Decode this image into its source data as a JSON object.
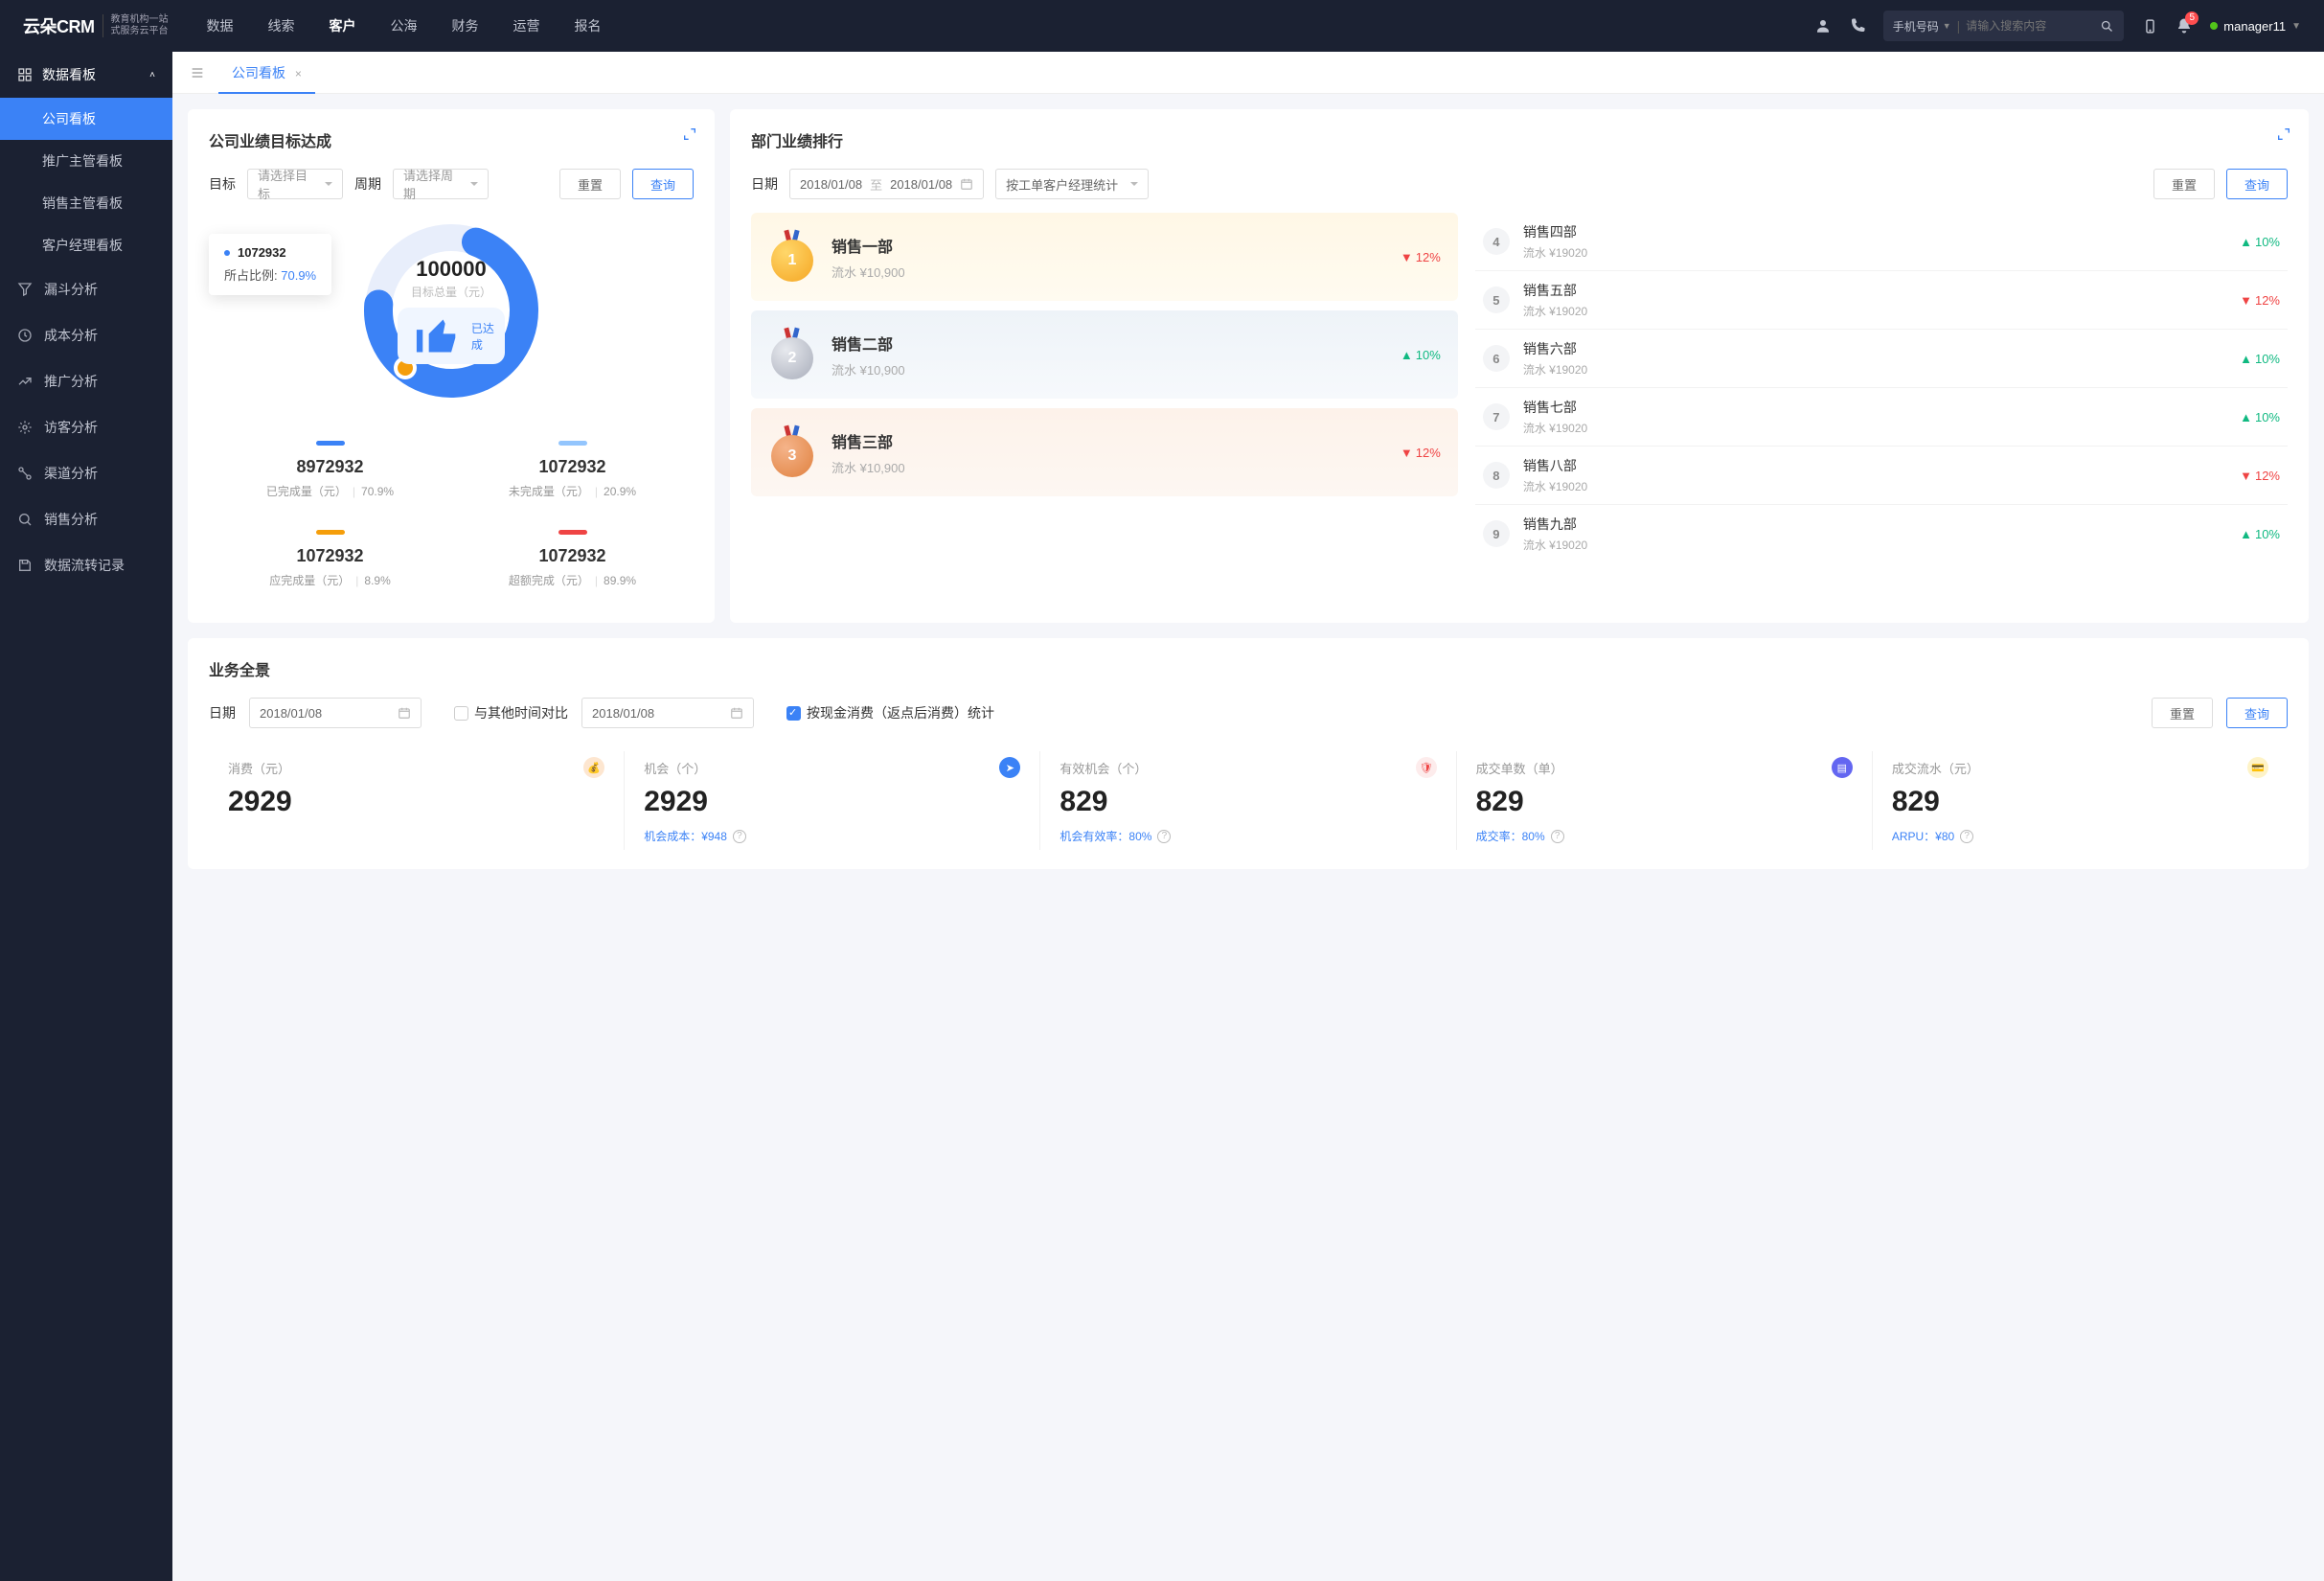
{
  "brand": {
    "name": "云朵CRM",
    "sub1": "教育机构一站",
    "sub2": "式服务云平台"
  },
  "topnav": [
    "数据",
    "线索",
    "客户",
    "公海",
    "财务",
    "运营",
    "报名"
  ],
  "topnav_active": 2,
  "search": {
    "type": "手机号码",
    "placeholder": "请输入搜索内容"
  },
  "notif_count": "5",
  "user": "manager11",
  "sidebar": {
    "group": {
      "title": "数据看板",
      "items": [
        "公司看板",
        "推广主管看板",
        "销售主管看板",
        "客户经理看板"
      ],
      "active": 0
    },
    "singles": [
      "漏斗分析",
      "成本分析",
      "推广分析",
      "访客分析",
      "渠道分析",
      "销售分析",
      "数据流转记录"
    ]
  },
  "tab": {
    "label": "公司看板"
  },
  "panelA": {
    "title": "公司业绩目标达成",
    "labels": {
      "target": "目标",
      "target_ph": "请选择目标",
      "period": "周期",
      "period_ph": "请选择周期",
      "reset": "重置",
      "query": "查询"
    },
    "tooltip": {
      "value": "1072932",
      "ratio_label": "所占比例:",
      "ratio": "70.9%"
    },
    "center": {
      "total": "100000",
      "sub": "目标总量（元）",
      "achieved": "已达成"
    },
    "stats": [
      {
        "color": "blue",
        "value": "8972932",
        "label": "已完成量（元）",
        "pct": "70.9%"
      },
      {
        "color": "lightblue",
        "value": "1072932",
        "label": "未完成量（元）",
        "pct": "20.9%"
      },
      {
        "color": "orange",
        "value": "1072932",
        "label": "应完成量（元）",
        "pct": "8.9%"
      },
      {
        "color": "red",
        "value": "1072932",
        "label": "超额完成（元）",
        "pct": "89.9%"
      }
    ]
  },
  "panelB": {
    "title": "部门业绩排行",
    "labels": {
      "date": "日期",
      "date_from": "2018/01/08",
      "date_sep": "至",
      "date_to": "2018/01/08",
      "group": "按工单客户经理统计",
      "reset": "重置",
      "query": "查询"
    },
    "top3": [
      {
        "rank": "1",
        "medal": "gold",
        "name": "销售一部",
        "amount": "流水 ¥10,900",
        "change": "12%",
        "dir": "down"
      },
      {
        "rank": "2",
        "medal": "silver",
        "name": "销售二部",
        "amount": "流水 ¥10,900",
        "change": "10%",
        "dir": "up"
      },
      {
        "rank": "3",
        "medal": "bronze",
        "name": "销售三部",
        "amount": "流水 ¥10,900",
        "change": "12%",
        "dir": "down"
      }
    ],
    "rest": [
      {
        "rank": "4",
        "name": "销售四部",
        "amount": "流水 ¥19020",
        "change": "10%",
        "dir": "up"
      },
      {
        "rank": "5",
        "name": "销售五部",
        "amount": "流水 ¥19020",
        "change": "12%",
        "dir": "down"
      },
      {
        "rank": "6",
        "name": "销售六部",
        "amount": "流水 ¥19020",
        "change": "10%",
        "dir": "up"
      },
      {
        "rank": "7",
        "name": "销售七部",
        "amount": "流水 ¥19020",
        "change": "10%",
        "dir": "up"
      },
      {
        "rank": "8",
        "name": "销售八部",
        "amount": "流水 ¥19020",
        "change": "12%",
        "dir": "down"
      },
      {
        "rank": "9",
        "name": "销售九部",
        "amount": "流水 ¥19020",
        "change": "10%",
        "dir": "up"
      }
    ]
  },
  "panelC": {
    "title": "业务全景",
    "labels": {
      "date": "日期",
      "date_val": "2018/01/08",
      "compare": "与其他时间对比",
      "compare_date": "2018/01/08",
      "stat_flag": "按现金消费（返点后消费）统计",
      "reset": "重置",
      "query": "查询"
    },
    "metrics": [
      {
        "head": "消费（元）",
        "icon": "orange",
        "value": "2929",
        "sublabel": "",
        "subval": ""
      },
      {
        "head": "机会（个）",
        "icon": "blue",
        "value": "2929",
        "sublabel": "机会成本：",
        "subval": "¥948"
      },
      {
        "head": "有效机会（个）",
        "icon": "red",
        "value": "829",
        "sublabel": "机会有效率：",
        "subval": "80%"
      },
      {
        "head": "成交单数（单）",
        "icon": "purple",
        "value": "829",
        "sublabel": "成交率：",
        "subval": "80%"
      },
      {
        "head": "成交流水（元）",
        "icon": "gold",
        "value": "829",
        "sublabel": "ARPU：",
        "subval": "¥80"
      }
    ]
  },
  "chart_data": {
    "type": "pie",
    "title": "公司业绩目标达成",
    "total_label": "目标总量（元）",
    "total": 100000,
    "series": [
      {
        "name": "已完成量（元）",
        "value": 8972932,
        "pct": 70.9
      },
      {
        "name": "未完成量（元）",
        "value": 1072932,
        "pct": 20.9
      },
      {
        "name": "应完成量（元）",
        "value": 1072932,
        "pct": 8.9
      },
      {
        "name": "超额完成（元）",
        "value": 1072932,
        "pct": 89.9
      }
    ],
    "annotation": {
      "value": 1072932,
      "ratio": 70.9
    }
  }
}
